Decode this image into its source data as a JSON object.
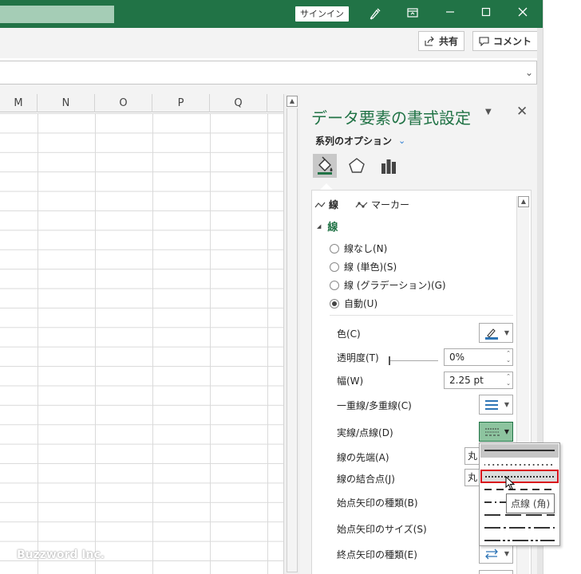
{
  "titlebar": {
    "signin_label": "サインイン"
  },
  "ribbon": {
    "share_label": "共有",
    "comment_label": "コメント"
  },
  "sheet": {
    "columns": [
      "M",
      "N",
      "O",
      "P",
      "Q"
    ]
  },
  "watermark": "Buzzword Inc.",
  "pane": {
    "title": "データ要素の書式設定",
    "series_options_label": "系列のオプション",
    "subtabs": {
      "line": "線",
      "marker": "マーカー"
    },
    "section_title": "線",
    "radios": [
      {
        "label": "線なし(N)",
        "selected": false
      },
      {
        "label": "線 (単色)(S)",
        "selected": false
      },
      {
        "label": "線 (グラデーション)(G)",
        "selected": false
      },
      {
        "label": "自動(U)",
        "selected": true
      }
    ],
    "props": {
      "color_label": "色(C)",
      "transparency_label": "透明度(T)",
      "transparency_value": "0%",
      "width_label": "幅(W)",
      "width_value": "2.25 pt",
      "compound_label": "一重線/多重線(C)",
      "dash_label": "実線/点線(D)",
      "cap_label": "線の先端(A)",
      "cap_value": "丸",
      "join_label": "線の結合点(J)",
      "join_value": "丸",
      "begin_arrow_type_label": "始点矢印の種類(B)",
      "begin_arrow_size_label": "始点矢印のサイズ(S)",
      "end_arrow_type_label": "終点矢印の種類(E)"
    }
  },
  "dash_menu": {
    "items": [
      "solid",
      "round-dot",
      "square-dot",
      "dash",
      "dash-dot",
      "long-dash",
      "long-dash-dot",
      "long-dash-dot-dot"
    ],
    "selected_index": 0,
    "hover_index": 2,
    "tooltip": "点線 (角)"
  },
  "colors": {
    "excel_green": "#217346",
    "highlight_red": "#d9111c",
    "active_dropdown": "#8dc49f"
  }
}
